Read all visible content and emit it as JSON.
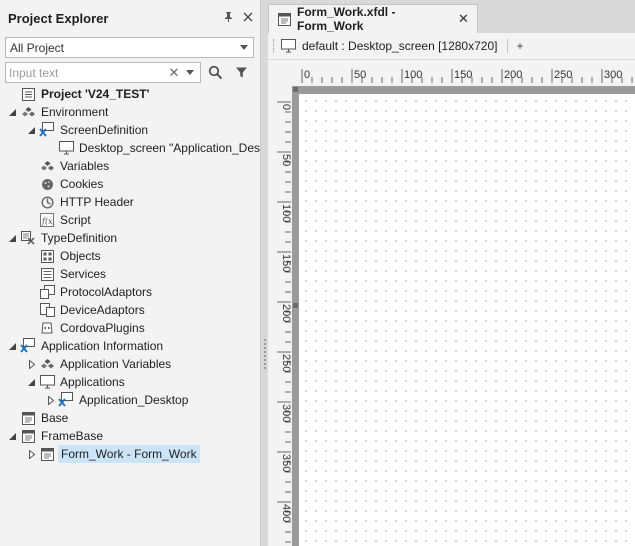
{
  "explorer": {
    "title": "Project Explorer",
    "scope_select": {
      "value": "All Project"
    },
    "search": {
      "placeholder": "Input text",
      "value": ""
    },
    "tree": [
      {
        "label": "Project 'V24_TEST'",
        "level": 0,
        "toggle": "none",
        "icon": "project-icon",
        "bold": true
      },
      {
        "label": "Environment",
        "level": 0,
        "toggle": "expanded",
        "icon": "environment-icon"
      },
      {
        "label": "ScreenDefinition",
        "level": 1,
        "toggle": "expanded",
        "icon": "screen-definition-icon"
      },
      {
        "label": "Desktop_screen \"Application_Des",
        "level": 2,
        "toggle": "none",
        "icon": "monitor-icon"
      },
      {
        "label": "Variables",
        "level": 1,
        "toggle": "none",
        "icon": "variables-icon"
      },
      {
        "label": "Cookies",
        "level": 1,
        "toggle": "none",
        "icon": "cookie-icon"
      },
      {
        "label": "HTTP Header",
        "level": 1,
        "toggle": "none",
        "icon": "http-header-icon"
      },
      {
        "label": "Script",
        "level": 1,
        "toggle": "none",
        "icon": "script-icon"
      },
      {
        "label": "TypeDefinition",
        "level": 0,
        "toggle": "expanded",
        "icon": "type-definition-icon"
      },
      {
        "label": "Objects",
        "level": 1,
        "toggle": "none",
        "icon": "objects-icon"
      },
      {
        "label": "Services",
        "level": 1,
        "toggle": "none",
        "icon": "services-icon"
      },
      {
        "label": "ProtocolAdaptors",
        "level": 1,
        "toggle": "none",
        "icon": "protocol-adaptors-icon"
      },
      {
        "label": "DeviceAdaptors",
        "level": 1,
        "toggle": "none",
        "icon": "device-adaptors-icon"
      },
      {
        "label": "CordovaPlugins",
        "level": 1,
        "toggle": "none",
        "icon": "cordova-plugins-icon"
      },
      {
        "label": "Application Information",
        "level": 0,
        "toggle": "expanded",
        "icon": "application-info-icon"
      },
      {
        "label": "Application Variables",
        "level": 1,
        "toggle": "collapsed",
        "icon": "variables-icon"
      },
      {
        "label": "Applications",
        "level": 1,
        "toggle": "expanded",
        "icon": "applications-icon"
      },
      {
        "label": "Application_Desktop",
        "level": 2,
        "toggle": "collapsed",
        "icon": "application-desktop-icon"
      },
      {
        "label": "Base",
        "level": 0,
        "toggle": "none",
        "icon": "form-icon"
      },
      {
        "label": "FrameBase",
        "level": 0,
        "toggle": "expanded",
        "icon": "form-icon"
      },
      {
        "label": "Form_Work - Form_Work",
        "level": 1,
        "toggle": "collapsed",
        "icon": "form-icon",
        "selected": true
      }
    ]
  },
  "editor": {
    "tab_label": "Form_Work.xfdl - Form_Work",
    "screen_label": "default : Desktop_screen [1280x720]",
    "add_label": "+",
    "h_ruler_ticks": [
      "0",
      "50",
      "100",
      "150",
      "200",
      "250",
      "300"
    ],
    "v_ruler_ticks": [
      "0",
      "50",
      "100",
      "150",
      "200",
      "250",
      "300",
      "350",
      "400"
    ]
  }
}
